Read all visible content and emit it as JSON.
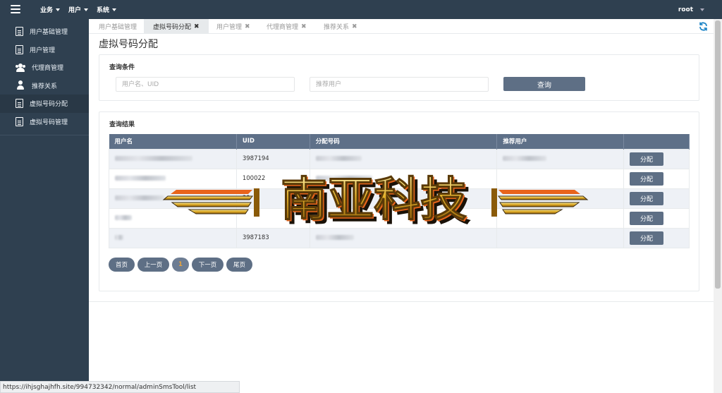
{
  "topbar": {
    "nav": [
      {
        "label": "业务"
      },
      {
        "label": "用户"
      },
      {
        "label": "系统"
      }
    ],
    "user": "root"
  },
  "sidebar": {
    "items": [
      {
        "label": "用户基础管理",
        "icon": "document-icon"
      },
      {
        "label": "用户管理",
        "icon": "document-icon"
      },
      {
        "label": "代理商管理",
        "icon": "users-icon"
      },
      {
        "label": "推荐关系",
        "icon": "user-icon"
      },
      {
        "label": "虚拟号码分配",
        "icon": "document-icon",
        "active": true
      },
      {
        "label": "虚拟号码管理",
        "icon": "document-icon"
      }
    ]
  },
  "tabs": [
    {
      "label": "用户基础管理",
      "closable": false
    },
    {
      "label": "虚拟号码分配",
      "closable": true,
      "active": true
    },
    {
      "label": "用户管理",
      "closable": true
    },
    {
      "label": "代理商管理",
      "closable": true
    },
    {
      "label": "推荐关系",
      "closable": true
    }
  ],
  "tab_close_glyph": "✖",
  "page_title": "虚拟号码分配",
  "query": {
    "title": "查询条件",
    "username_placeholder": "用户名、UID",
    "referrer_placeholder": "推荐用户",
    "button": "查询"
  },
  "results": {
    "title": "查询结果",
    "columns": [
      "用户名",
      "UID",
      "分配号码",
      "推荐用户",
      ""
    ],
    "rows": [
      {
        "uid": "3987194",
        "action": "分配"
      },
      {
        "uid": "100022",
        "action": "分配"
      },
      {
        "uid": "39",
        "action": "分配"
      },
      {
        "uid": "",
        "action": "分配"
      },
      {
        "uid": "3987183",
        "action": "分配"
      }
    ]
  },
  "pager": {
    "first": "首页",
    "prev": "上一页",
    "current": "1",
    "next": "下一页",
    "last": "尾页"
  },
  "watermark_text": "南亚科技",
  "status_url": "https://ihjsghajhfh.site/994732342/normal/adminSmsTool/list",
  "colors": {
    "nav_bg": "#2f4050",
    "sidebar_active": "#293846",
    "button": "#5e6f85",
    "table_header": "#5e7088",
    "refresh": "#1c84c6",
    "watermark_gold": "#d9a520",
    "watermark_orange": "#e8641c"
  }
}
